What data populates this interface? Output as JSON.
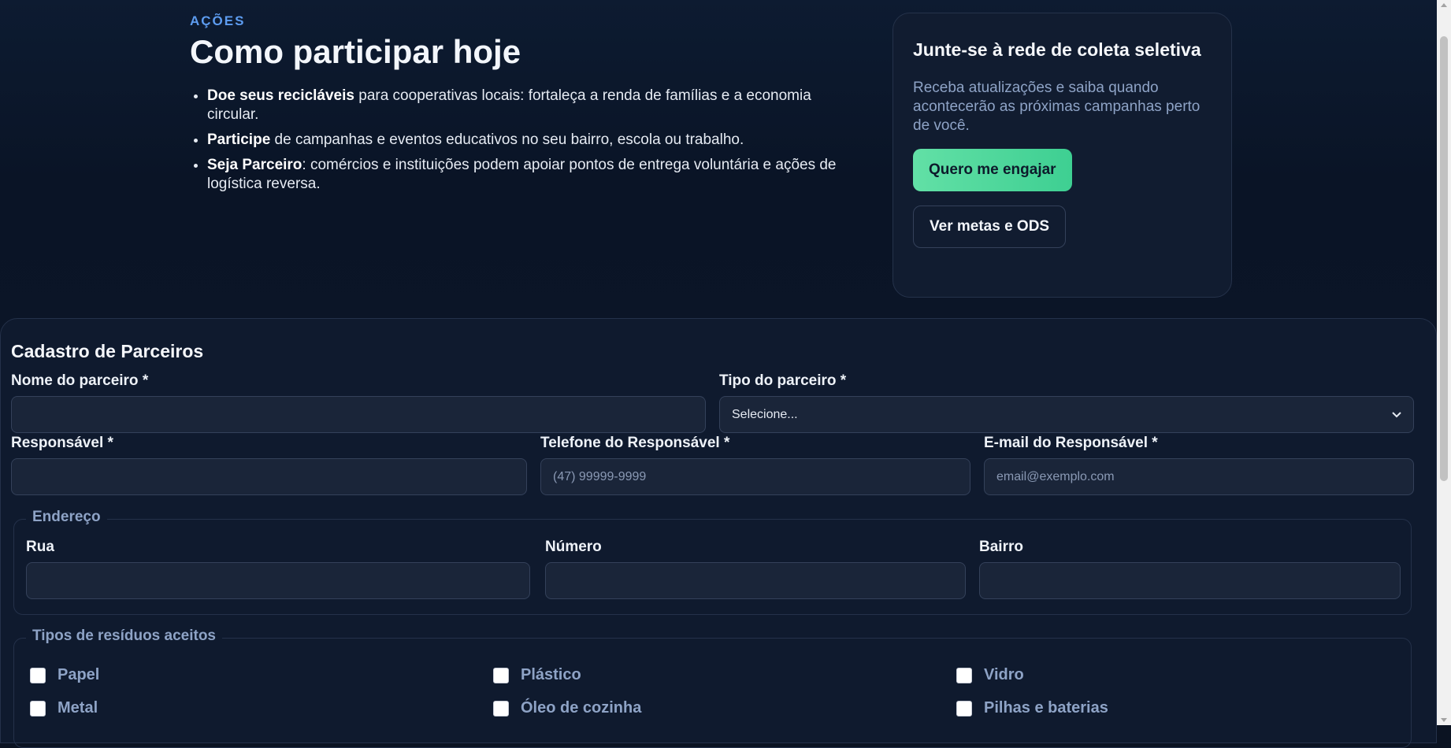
{
  "hero": {
    "eyebrow": "AÇÕES",
    "title": "Como participar hoje",
    "bullets": [
      {
        "strong": "Doe seus recicláveis",
        "text": " para cooperativas locais: fortaleça a renda de famílias e a economia circular."
      },
      {
        "strong": "Participe",
        "text": " de campanhas e eventos educativos no seu bairro, escola ou trabalho."
      },
      {
        "strong": "Seja Parceiro",
        "text": ": comércios e instituições podem apoiar pontos de entrega voluntária e ações de logística reversa."
      }
    ]
  },
  "card": {
    "title": "Junte-se à rede de coleta seletiva",
    "text": "Receba atualizações e saiba quando acontecerão as próximas campanhas perto de você.",
    "primary_label": "Quero me engajar",
    "secondary_label": "Ver metas e ODS"
  },
  "form": {
    "title": "Cadastro de Parceiros",
    "nome_label": "Nome do parceiro *",
    "nome_value": "",
    "tipo_label": "Tipo do parceiro *",
    "tipo_selected": "Selecione...",
    "responsavel_label": "Responsável *",
    "responsavel_value": "",
    "telefone_label": "Telefone do Responsável *",
    "telefone_placeholder": "(47) 99999-9999",
    "email_label": "E-mail do Responsável *",
    "email_placeholder": "email@exemplo.com",
    "endereco": {
      "legend": "Endereço",
      "rua_label": "Rua",
      "numero_label": "Número",
      "bairro_label": "Bairro"
    },
    "residuos": {
      "legend": "Tipos de resíduos aceitos",
      "options": [
        {
          "label": "Papel",
          "checked": false
        },
        {
          "label": "Plástico",
          "checked": false
        },
        {
          "label": "Vidro",
          "checked": false
        },
        {
          "label": "Metal",
          "checked": false
        },
        {
          "label": "Óleo de cozinha",
          "checked": false
        },
        {
          "label": "Pilhas e baterias",
          "checked": false
        }
      ]
    }
  },
  "colors": {
    "accent_green": "#4fd69c",
    "accent_blue": "#5d9cf0",
    "background": "#0b1322"
  },
  "icons": {
    "select_arrow": "chevron-down-icon"
  }
}
